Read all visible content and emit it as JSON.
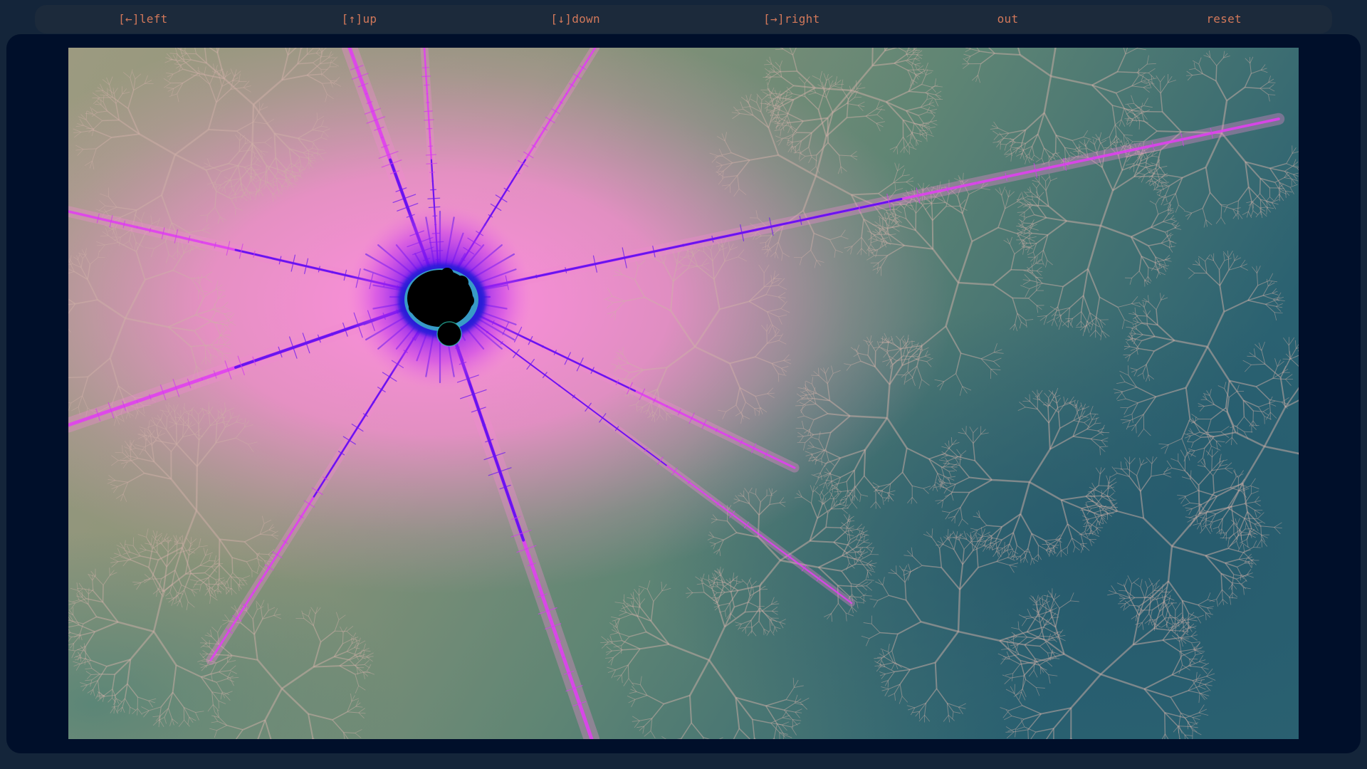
{
  "toolbar": {
    "buttons": [
      {
        "id": "left",
        "label": "[←]left"
      },
      {
        "id": "up",
        "label": "[↑]up"
      },
      {
        "id": "down",
        "label": "[↓]down"
      },
      {
        "id": "right",
        "label": "[→]right"
      },
      {
        "id": "out",
        "label": "out"
      },
      {
        "id": "reset",
        "label": "reset"
      }
    ]
  },
  "colors": {
    "page_bg": "#14253a",
    "toolbar_bg": "#1c2a3b",
    "button_text": "#d2785a",
    "viewer_bg": "#000f2a",
    "fractal_pink": "#f08ad0",
    "fractal_magenta": "#e040f0",
    "fractal_violet": "#5a10f0",
    "fractal_sage": "#7d9278",
    "fractal_teal": "#2b6270",
    "fractal_core": "#000000"
  }
}
